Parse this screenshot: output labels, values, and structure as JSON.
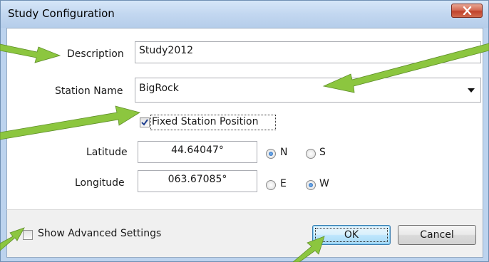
{
  "window": {
    "title": "Study Configuration"
  },
  "form": {
    "description_label": "Description",
    "description_value": "Study2012",
    "station_name_label": "Station Name",
    "station_name_value": "BigRock",
    "fixed_position_label": "Fixed Station Position",
    "fixed_position_checked": true,
    "latitude_label": "Latitude",
    "latitude_value": "44.64047°",
    "lat_north_label": "N",
    "lat_south_label": "S",
    "lat_selected": "N",
    "longitude_label": "Longitude",
    "longitude_value": "063.67085°",
    "lon_east_label": "E",
    "lon_west_label": "W",
    "lon_selected": "W"
  },
  "footer": {
    "advanced_label": "Show Advanced Settings",
    "advanced_checked": false,
    "ok_label": "OK",
    "cancel_label": "Cancel"
  },
  "colors": {
    "callout_arrow": "#8cc63f",
    "title_bar": "#c2d7f0",
    "close_button": "#c1422c"
  },
  "icons": [
    "close-icon",
    "checkmark-icon",
    "dropdown-arrow-icon"
  ]
}
